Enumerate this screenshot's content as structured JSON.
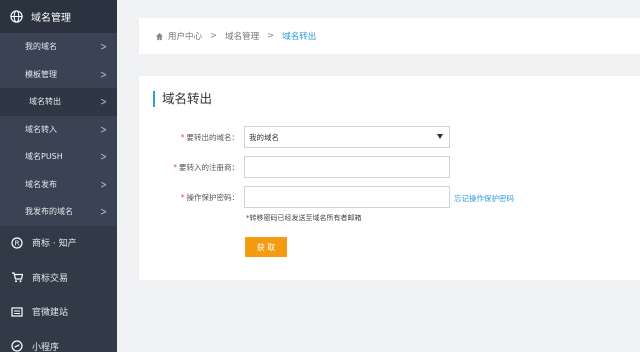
{
  "sidebar": {
    "header": {
      "label": "域名管理",
      "icon": "globe-icon"
    },
    "sub_items": [
      {
        "label": "我的域名"
      },
      {
        "label": "模板管理"
      },
      {
        "label": "域名转出"
      },
      {
        "label": "域名转入"
      },
      {
        "label": "域名PUSH"
      },
      {
        "label": "域名发布"
      },
      {
        "label": "我发布的域名"
      }
    ],
    "items": [
      {
        "label": "商标 · 知产",
        "icon": "registered-icon"
      },
      {
        "label": "商标交易",
        "icon": "cart-icon"
      },
      {
        "label": "官微建站",
        "icon": "website-icon"
      },
      {
        "label": "小程序",
        "icon": "mini-program-icon"
      }
    ],
    "chevron": ">"
  },
  "breadcrumb": {
    "home": "用户中心",
    "level2": "域名管理",
    "current": "域名转出",
    "sep": ">"
  },
  "form": {
    "title": "域名转出",
    "req_mark": "*",
    "fields": {
      "domain_label": "要转出的域名：",
      "domain_value": "我的域名",
      "registrar_label": "要转入的注册商：",
      "registrar_value": "",
      "password_label": "操作保护密码：",
      "password_value": ""
    },
    "forgot_link": "忘记操作保护密码",
    "note": "*转移密码已经发送至域名所有者邮箱",
    "submit": "获 取"
  },
  "colors": {
    "sidebar_bg": "#323a48",
    "accent": "#2d9cdb",
    "button": "#f39c12",
    "required": "#e35050"
  }
}
